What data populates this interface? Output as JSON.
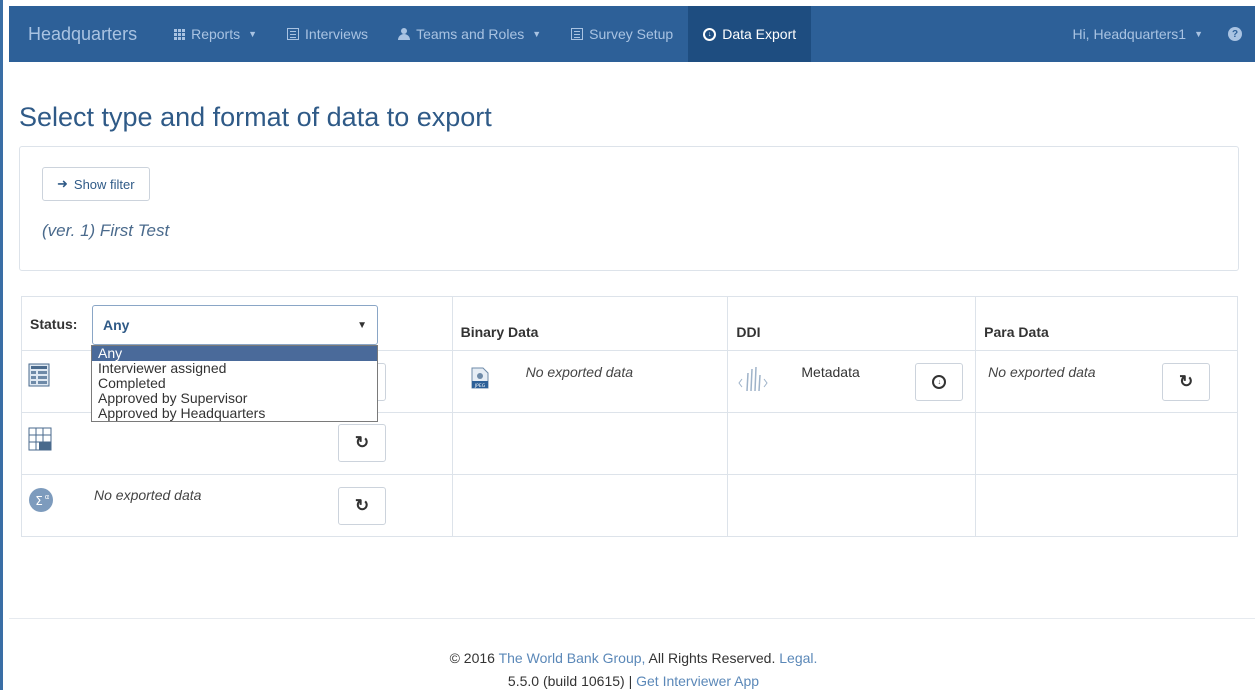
{
  "nav": {
    "brand": "Headquarters",
    "items": [
      {
        "label": "Reports",
        "icon": "grid-icon",
        "dropdown": true
      },
      {
        "label": "Interviews",
        "icon": "list-icon",
        "dropdown": false
      },
      {
        "label": "Teams and Roles",
        "icon": "user-icon",
        "dropdown": true
      },
      {
        "label": "Survey Setup",
        "icon": "list-icon",
        "dropdown": false
      },
      {
        "label": "Data Export",
        "icon": "download-circle-icon",
        "dropdown": false,
        "active": true
      }
    ],
    "user_greeting": "Hi, Headquarters1",
    "help": "?"
  },
  "page": {
    "title": "Select type and format of data to export"
  },
  "filter": {
    "show_filter_label": "Show filter",
    "version": "(ver. 1) First Test"
  },
  "table": {
    "status_label": "Status:",
    "status_value": "Any",
    "headers": {
      "binary": "Binary Data",
      "ddi": "DDI",
      "para": "Para Data"
    },
    "status_options": [
      "Any",
      "Interviewer assigned",
      "Completed",
      "Approved by Supervisor",
      "Approved by Headquarters"
    ],
    "binary_nodata": "No exported data",
    "ddi_label": "Metadata",
    "para_nodata": "No exported data",
    "row3_nodata": "No exported data",
    "jpeg_label": "JPEG"
  },
  "footer": {
    "copyright": "© 2016",
    "org": "The World Bank Group,",
    "rights": "All Rights Reserved.",
    "legal": "Legal.",
    "version": "5.5.0 (build 10615)",
    "separator": "|",
    "app_link": "Get Interviewer App"
  },
  "colors": {
    "navbar": "#2d6098",
    "navbar_active": "#1e4d80",
    "title": "#2f5a87",
    "link": "#5b88b8"
  }
}
